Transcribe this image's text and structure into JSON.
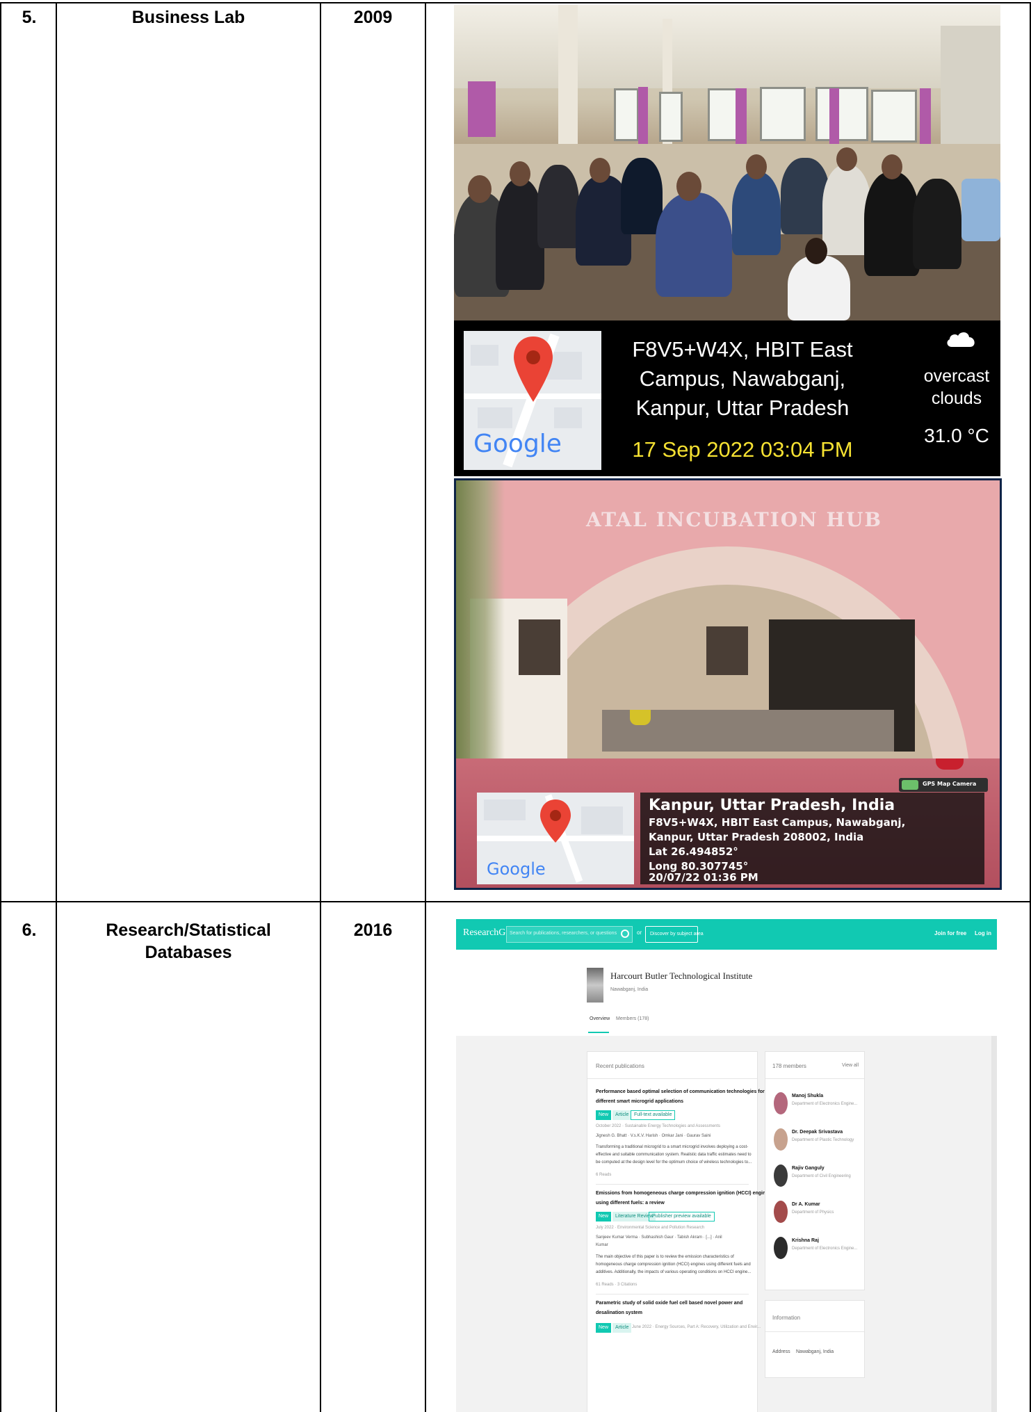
{
  "rows": [
    {
      "serial": "5.",
      "facility": "Business Lab",
      "year": "2009"
    },
    {
      "serial": "6.",
      "facility_line1": "Research/Statistical",
      "facility_line2": "Databases",
      "year": "2016"
    }
  ],
  "photo1_geotag": {
    "map_brand": "Google",
    "address_line1": "F8V5+W4X, HBIT East",
    "address_line2": "Campus, Nawabganj,",
    "address_line3": "Kanpur, Uttar Pradesh",
    "datetime": "17 Sep 2022 03:04 PM",
    "weather_line1": "overcast",
    "weather_line2": "clouds",
    "temperature": "31.0 °C",
    "weather_icon": "cloud-icon"
  },
  "photo2": {
    "sign_text": "ATAL INCUBATION HUB",
    "app_label": "GPS Map Camera",
    "map_brand": "Google",
    "title": "Kanpur, Uttar Pradesh, India",
    "line1": "F8V5+W4X, HBIT East Campus, Nawabganj,",
    "line2": "Kanpur, Uttar Pradesh 208002, India",
    "lat": "Lat 26.494852°",
    "long": "Long 80.307745°",
    "datetime": "20/07/22 01:36 PM"
  },
  "researchgate": {
    "logo": "ResearchGate",
    "search_placeholder": "Search for publications, researchers, or questions",
    "or": "or",
    "discover": "Discover by subject area",
    "join": "Join for free",
    "login": "Log in",
    "institution": "Harcourt Butler Technological Institute",
    "location": "Nawabganj, India",
    "tab_overview": "Overview",
    "tab_members": "Members (178)",
    "recent_title": "Recent publications",
    "members_title": "178 members",
    "view_all": "View all",
    "pubs": [
      {
        "title1": "Performance based optimal selection of communication technologies for",
        "title2": "different smart microgrid applications",
        "badges": [
          "New",
          "Article",
          "Full-text available"
        ],
        "meta": "October 2022 · Sustainable Energy Technologies and Assessments",
        "authors": "Jignesh G. Bhatt · V.s.K.V. Harish · Omkar Jani · Gaurav Saini",
        "abs1": "Transforming a traditional microgrid to a smart microgrid involves deploying a cost-",
        "abs2": "effective and suitable communication system. Realistic data traffic estimates need to",
        "abs3": "be computed at the design level for the optimum choice of wireless technologies to...",
        "stats": "6 Reads"
      },
      {
        "title1": "Emissions from homogeneous charge compression ignition (HCCI) engine",
        "title2": "using different fuels: a review",
        "badges": [
          "New",
          "Literature Review",
          "Publisher preview available"
        ],
        "meta": "July 2022 · Environmental Science and Pollution Research",
        "authors": "Sanjeev Kumar Verma · Subhashish Gaur · Tabish Akram · [...] · Anil",
        "authors2": "Kumar",
        "abs1": "The main objective of this paper is to review the emission characteristics of",
        "abs2": "homogeneous charge compression ignition (HCCI) engines using different fuels and",
        "abs3": "additives. Additionally, the impacts of various operating conditions on HCCI engine...",
        "stats": "61 Reads · 3 Citations"
      },
      {
        "title1": "Parametric study of solid oxide fuel cell based novel power and",
        "title2": "desalination system",
        "badges": [
          "New",
          "Article"
        ],
        "meta": "June 2022 · Energy Sources, Part A: Recovery, Utilization and Envir..."
      }
    ],
    "members": [
      {
        "name": "Manoj Shukla",
        "dept": "Department of Electronics Engine..."
      },
      {
        "name": "Dr. Deepak Srivastava",
        "dept": "Department of Plastic Technology"
      },
      {
        "name": "Rajiv Ganguly",
        "dept": "Department of Civil Engineering"
      },
      {
        "name": "Dr A. Kumar",
        "dept": "Department of Physics"
      },
      {
        "name": "Krishna Raj",
        "dept": "Department of Electronics Engine..."
      }
    ],
    "info_title": "Information",
    "address_label": "Address",
    "address_value": "Nawabganj, India"
  }
}
